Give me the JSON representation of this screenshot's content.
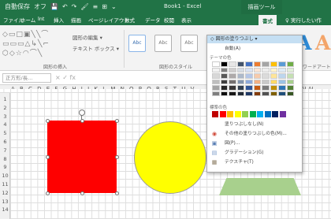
{
  "app": {
    "qat": [
      "自動保存",
      "オフ",
      "💾",
      "↶",
      "↷",
      "🖌",
      "≡",
      "⊞",
      "⌄"
    ],
    "title": "Book1 - Excel",
    "context_tab": "描画ツール"
  },
  "ribbon_tabs": [
    {
      "label": "ファイル",
      "active": false
    },
    {
      "label": "ホーム",
      "active": false
    },
    {
      "label": "lnt",
      "active": false
    },
    {
      "label": "挿入",
      "active": false
    },
    {
      "label": "描画",
      "active": false
    },
    {
      "label": "ページレイアウト",
      "active": false
    },
    {
      "label": "数式",
      "active": false
    },
    {
      "label": "データ",
      "active": false
    },
    {
      "label": "校閲",
      "active": false
    },
    {
      "label": "表示",
      "active": false
    },
    {
      "label": "書式",
      "active": true
    },
    {
      "label": "♀ 実行したい作",
      "active": false
    }
  ],
  "ribbon": {
    "shapes_gallery": "◇▭□▣╲╲⌒\n▭▭▭△↳╲⌐\n⬡◇☆◠⌒╲",
    "edit_shape": "図形の編集 ▾",
    "text_box": "テキスト ボックス ▾",
    "insert_group": "図形の挿入",
    "styles_group": "図形のスタイル",
    "wordart_group": "ワードアートのス",
    "style_box_label": "Abc",
    "fill_btn": "◇ 図形の塗りつぶし ▾",
    "wordart_letter": "A",
    "wordart_accent": "#2f8bd6",
    "wordart_accent2": "#f3a56a"
  },
  "formula_bar": {
    "name_box": "正方形/長...",
    "icons": "× ✓ fx"
  },
  "sheet": {
    "columns": "A B C D E F G H I J K L M N O P Q R S T U V",
    "columns_right": "FAGAH AI AJ",
    "rows": [
      "1",
      "2",
      "3",
      "4",
      "5",
      "6",
      "7",
      "8",
      "9",
      "10",
      "11",
      "12",
      "13",
      "14"
    ]
  },
  "shapes": {
    "red_color": "#fe0000",
    "yellow_color": "#ffff00",
    "green_color": "#a8d08d"
  },
  "fill_menu": {
    "header": "◇ 図形の塗りつぶし ▾",
    "item_auto": "自動(A)",
    "theme_label": "テーマの色",
    "standard_label": "標準の色",
    "no_fill": "塗りつぶしなし(N)",
    "more_colors": "その他の塗りつぶしの色(M)...",
    "picture": "図(P)...",
    "gradient": "グラデーション(G)",
    "texture": "テクスチャ(T)",
    "standard_colors": [
      "#c00000",
      "#ff0000",
      "#ffc000",
      "#ffff00",
      "#92d050",
      "#00b050",
      "#00b0f0",
      "#0070c0",
      "#002060",
      "#7030a0"
    ],
    "theme_colors": [
      "#ffffff",
      "#000000",
      "#e7e6e6",
      "#44546a",
      "#4472c4",
      "#ed7d31",
      "#a5a5a5",
      "#ffc000",
      "#5b9bd5",
      "#70ad47",
      "#f2f2f2",
      "#808080",
      "#d0cece",
      "#d6dce4",
      "#d9e2f3",
      "#fbe5d5",
      "#ededed",
      "#fff2cc",
      "#deebf6",
      "#e2efd9",
      "#d8d8d8",
      "#595959",
      "#aeaaaa",
      "#adb9ca",
      "#b4c6e7",
      "#f7cbac",
      "#dbdbdb",
      "#fee599",
      "#bdd6ee",
      "#c5e0b3",
      "#bfbfbf",
      "#3f3f3f",
      "#757070",
      "#8496b0",
      "#8eaadb",
      "#f4b183",
      "#c9c9c9",
      "#ffd965",
      "#9cc3e5",
      "#a8d08d",
      "#a5a5a5",
      "#262626",
      "#3a3838",
      "#323f4f",
      "#2f5496",
      "#c55a11",
      "#7b7b7b",
      "#bf9000",
      "#2e75b5",
      "#538135",
      "#7f7f7f",
      "#0c0c0c",
      "#171616",
      "#222a35",
      "#1f3864",
      "#833c0b",
      "#525252",
      "#7f6000",
      "#1f4e79",
      "#375623"
    ]
  }
}
